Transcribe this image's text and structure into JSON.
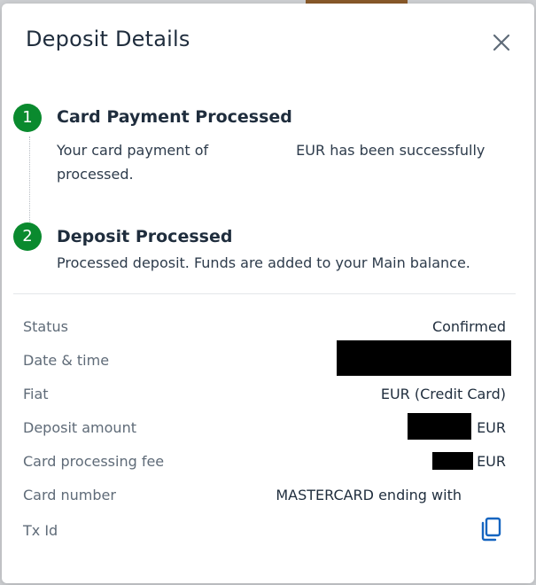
{
  "modal": {
    "title": "Deposit Details",
    "close_icon": "close-icon"
  },
  "steps": [
    {
      "number": "1",
      "title": "Card Payment Processed",
      "desc_prefix": "Your card payment of",
      "desc_suffix": "EUR has been successfully",
      "desc_line2": "processed.",
      "badge_color": "#0a8a2e"
    },
    {
      "number": "2",
      "title": "Deposit Processed",
      "desc": "Processed deposit. Funds are added to your Main balance.",
      "badge_color": "#0a8a2e"
    }
  ],
  "details": {
    "status": {
      "label": "Status",
      "value": "Confirmed"
    },
    "datetime": {
      "label": "Date & time"
    },
    "fiat": {
      "label": "Fiat",
      "value": "EUR (Credit Card)"
    },
    "deposit_amount": {
      "label": "Deposit amount",
      "currency": "EUR"
    },
    "card_fee": {
      "label": "Card processing fee",
      "currency": "EUR"
    },
    "card_number": {
      "label": "Card number",
      "value": "MASTERCARD ending with"
    },
    "tx_id": {
      "label": "Tx Id",
      "icon": "copy-icon"
    }
  },
  "colors": {
    "accent": "#1565c0",
    "success": "#0a8a2e",
    "text_primary": "#1f2d3d",
    "text_secondary": "#5f6b78"
  }
}
